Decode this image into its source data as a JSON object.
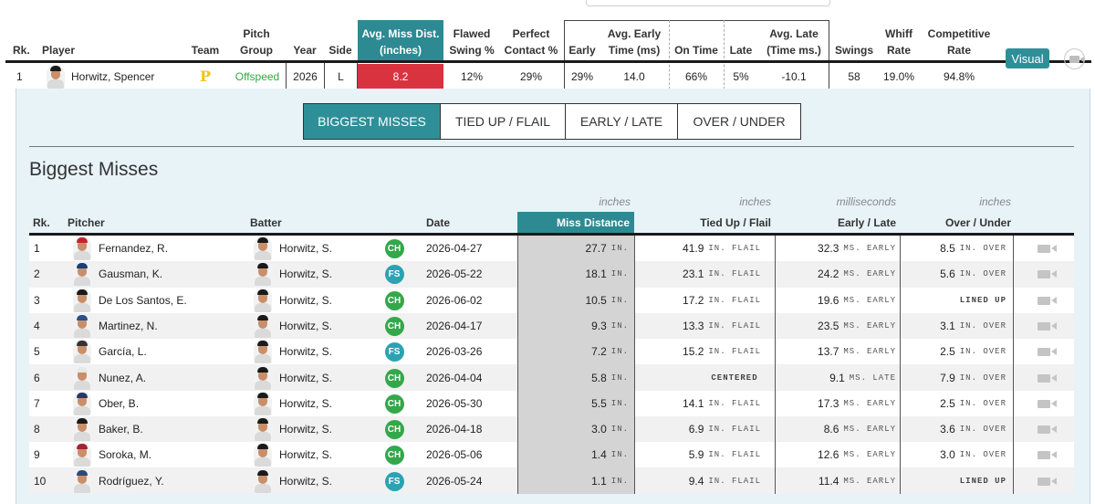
{
  "top_table": {
    "headers": {
      "rk": "Rk.",
      "player": "Player",
      "team": "Team",
      "pitch_group": "Pitch Group",
      "year": "Year",
      "side": "Side",
      "avg_miss": "Avg. Miss Dist. (inches)",
      "flawed_swing": "Flawed Swing %",
      "perfect_contact": "Perfect Contact %",
      "early": "Early",
      "avg_early_time": "Avg. Early Time (ms)",
      "on_time": "On Time",
      "late": "Late",
      "avg_late_time": "Avg. Late (Time ms.)",
      "swings": "Swings",
      "whiff_rate": "Whiff Rate",
      "competitive_rate": "Competitive Rate"
    },
    "row": {
      "rk": "1",
      "player": "Horwitz, Spencer",
      "team_logo": "P",
      "pitch_group": "Offspeed",
      "year": "2026",
      "side": "L",
      "avg_miss": "8.2",
      "flawed_swing": "12%",
      "perfect_contact": "29%",
      "early": "29%",
      "avg_early_time": "14.0",
      "on_time": "66%",
      "late": "5%",
      "avg_late_time": "-10.1",
      "swings": "58",
      "whiff_rate": "19.0%",
      "competitive_rate": "94.8%",
      "visual_button": "Visual",
      "video_icon": "video-camera-icon"
    },
    "colors": {
      "accent": "#2d8a93",
      "highlight_red": "#d9333f",
      "offspeed_green": "#2eaa3d",
      "team_gold": "#f2c318"
    }
  },
  "tabs": [
    {
      "label": "BIGGEST MISSES",
      "active": true
    },
    {
      "label": "TIED UP / FLAIL",
      "active": false
    },
    {
      "label": "EARLY / LATE",
      "active": false
    },
    {
      "label": "OVER / UNDER",
      "active": false
    }
  ],
  "section_title": "Biggest Misses",
  "units": {
    "miss": "inches",
    "tied": "inches",
    "early_late": "milliseconds",
    "over_under": "inches"
  },
  "misses_table": {
    "headers": {
      "rk": "Rk.",
      "pitcher": "Pitcher",
      "batter": "Batter",
      "date": "Date",
      "miss_distance": "Miss Distance",
      "tied_up_flail": "Tied Up / Flail",
      "early_late": "Early / Late",
      "over_under": "Over / Under"
    },
    "rows": [
      {
        "rk": "1",
        "pitcher": "Fernandez, R.",
        "batter": "Horwitz, S.",
        "pitch": "CH",
        "date": "2026-04-27",
        "miss": "27.7",
        "miss_unit": "IN.",
        "tied": "41.9",
        "tied_unit": "IN. FLAIL",
        "tied_tag": "",
        "el": "32.3",
        "el_unit": "MS. EARLY",
        "ou": "8.5",
        "ou_unit": "IN. OVER",
        "ou_tag": ""
      },
      {
        "rk": "2",
        "pitcher": "Gausman, K.",
        "batter": "Horwitz, S.",
        "pitch": "FS",
        "date": "2026-05-22",
        "miss": "18.1",
        "miss_unit": "IN.",
        "tied": "23.1",
        "tied_unit": "IN. FLAIL",
        "tied_tag": "",
        "el": "24.2",
        "el_unit": "MS. EARLY",
        "ou": "5.6",
        "ou_unit": "IN. OVER",
        "ou_tag": ""
      },
      {
        "rk": "3",
        "pitcher": "De Los Santos, E.",
        "batter": "Horwitz, S.",
        "pitch": "CH",
        "date": "2026-06-02",
        "miss": "10.5",
        "miss_unit": "IN.",
        "tied": "17.2",
        "tied_unit": "IN. FLAIL",
        "tied_tag": "",
        "el": "19.6",
        "el_unit": "MS. EARLY",
        "ou": "",
        "ou_unit": "",
        "ou_tag": "LINED UP"
      },
      {
        "rk": "4",
        "pitcher": "Martinez, N.",
        "batter": "Horwitz, S.",
        "pitch": "CH",
        "date": "2026-04-17",
        "miss": "9.3",
        "miss_unit": "IN.",
        "tied": "13.3",
        "tied_unit": "IN. FLAIL",
        "tied_tag": "",
        "el": "23.5",
        "el_unit": "MS. EARLY",
        "ou": "3.1",
        "ou_unit": "IN. OVER",
        "ou_tag": ""
      },
      {
        "rk": "5",
        "pitcher": "García, L.",
        "batter": "Horwitz, S.",
        "pitch": "FS",
        "date": "2026-03-26",
        "miss": "7.2",
        "miss_unit": "IN.",
        "tied": "15.2",
        "tied_unit": "IN. FLAIL",
        "tied_tag": "",
        "el": "13.7",
        "el_unit": "MS. EARLY",
        "ou": "2.5",
        "ou_unit": "IN. OVER",
        "ou_tag": ""
      },
      {
        "rk": "6",
        "pitcher": "Nunez, A.",
        "batter": "Horwitz, S.",
        "pitch": "CH",
        "date": "2026-04-04",
        "miss": "5.8",
        "miss_unit": "IN.",
        "tied": "",
        "tied_unit": "",
        "tied_tag": "CENTERED",
        "el": "9.1",
        "el_unit": "MS. LATE",
        "ou": "7.9",
        "ou_unit": "IN. OVER",
        "ou_tag": ""
      },
      {
        "rk": "7",
        "pitcher": "Ober, B.",
        "batter": "Horwitz, S.",
        "pitch": "CH",
        "date": "2026-05-30",
        "miss": "5.5",
        "miss_unit": "IN.",
        "tied": "14.1",
        "tied_unit": "IN. FLAIL",
        "tied_tag": "",
        "el": "17.3",
        "el_unit": "MS. EARLY",
        "ou": "2.5",
        "ou_unit": "IN. OVER",
        "ou_tag": ""
      },
      {
        "rk": "8",
        "pitcher": "Baker, B.",
        "batter": "Horwitz, S.",
        "pitch": "CH",
        "date": "2026-04-18",
        "miss": "3.0",
        "miss_unit": "IN.",
        "tied": "6.9",
        "tied_unit": "IN. FLAIL",
        "tied_tag": "",
        "el": "8.6",
        "el_unit": "MS. EARLY",
        "ou": "3.6",
        "ou_unit": "IN. OVER",
        "ou_tag": ""
      },
      {
        "rk": "9",
        "pitcher": "Soroka, M.",
        "batter": "Horwitz, S.",
        "pitch": "CH",
        "date": "2026-05-06",
        "miss": "1.4",
        "miss_unit": "IN.",
        "tied": "5.9",
        "tied_unit": "IN. FLAIL",
        "tied_tag": "",
        "el": "12.6",
        "el_unit": "MS. EARLY",
        "ou": "3.0",
        "ou_unit": "IN. OVER",
        "ou_tag": ""
      },
      {
        "rk": "10",
        "pitcher": "Rodríguez, Y.",
        "batter": "Horwitz, S.",
        "pitch": "FS",
        "date": "2026-05-24",
        "miss": "1.1",
        "miss_unit": "IN.",
        "tied": "9.4",
        "tied_unit": "IN. FLAIL",
        "tied_tag": "",
        "el": "11.4",
        "el_unit": "MS. EARLY",
        "ou": "",
        "ou_unit": "",
        "ou_tag": "LINED UP"
      }
    ]
  }
}
